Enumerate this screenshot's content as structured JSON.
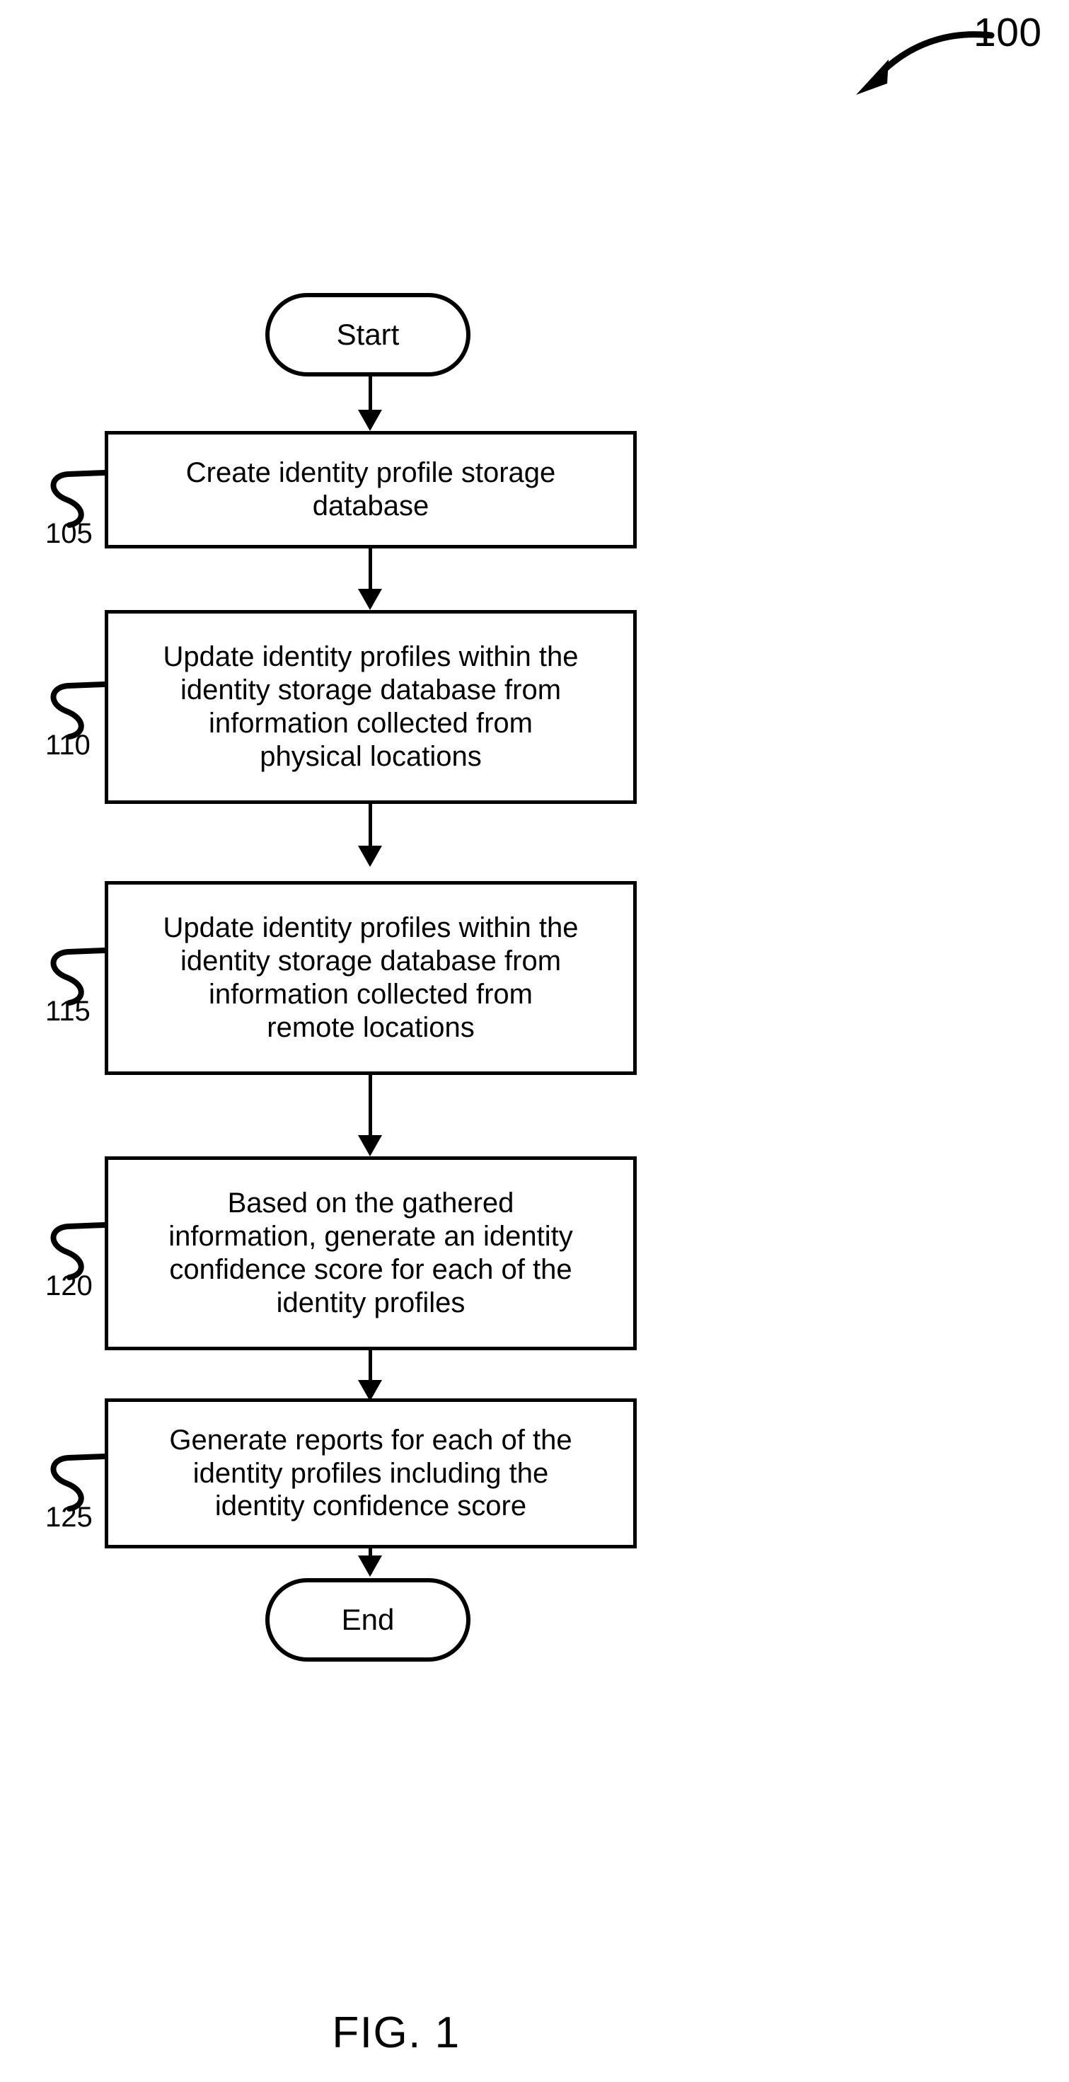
{
  "figure": {
    "caption": "FIG. 1",
    "reference_numeral": "100"
  },
  "flowchart": {
    "type": "flowchart",
    "orientation": "vertical",
    "stroke_color": "#000000",
    "fill_color": "#ffffff",
    "nodes": [
      {
        "id": "start",
        "shape": "terminal",
        "label": "Start",
        "ref": null
      },
      {
        "id": "step-105",
        "shape": "process",
        "label": "Create identity profile storage\ndatabase",
        "ref": "105"
      },
      {
        "id": "step-110",
        "shape": "process",
        "label": "Update identity profiles within the\nidentity storage database from\ninformation collected from\nphysical locations",
        "ref": "110"
      },
      {
        "id": "step-115",
        "shape": "process",
        "label": "Update identity profiles within the\nidentity storage database from\ninformation collected from\nremote locations",
        "ref": "115"
      },
      {
        "id": "step-120",
        "shape": "process",
        "label": "Based on the gathered\ninformation, generate an identity\nconfidence score for each of the\nidentity profiles",
        "ref": "120"
      },
      {
        "id": "step-125",
        "shape": "process",
        "label": "Generate reports for each of the\nidentity profiles including the\nidentity confidence score",
        "ref": "125"
      },
      {
        "id": "end",
        "shape": "terminal",
        "label": "End",
        "ref": null
      }
    ],
    "edges": [
      {
        "from": "start",
        "to": "step-105",
        "arrow": "down"
      },
      {
        "from": "step-105",
        "to": "step-110",
        "arrow": "down"
      },
      {
        "from": "step-110",
        "to": "step-115",
        "arrow": "down"
      },
      {
        "from": "step-115",
        "to": "step-120",
        "arrow": "down"
      },
      {
        "from": "step-120",
        "to": "step-125",
        "arrow": "down"
      },
      {
        "from": "step-125",
        "to": "end",
        "arrow": "down"
      }
    ],
    "reference_numerals": [
      "105",
      "110",
      "115",
      "120",
      "125"
    ]
  }
}
